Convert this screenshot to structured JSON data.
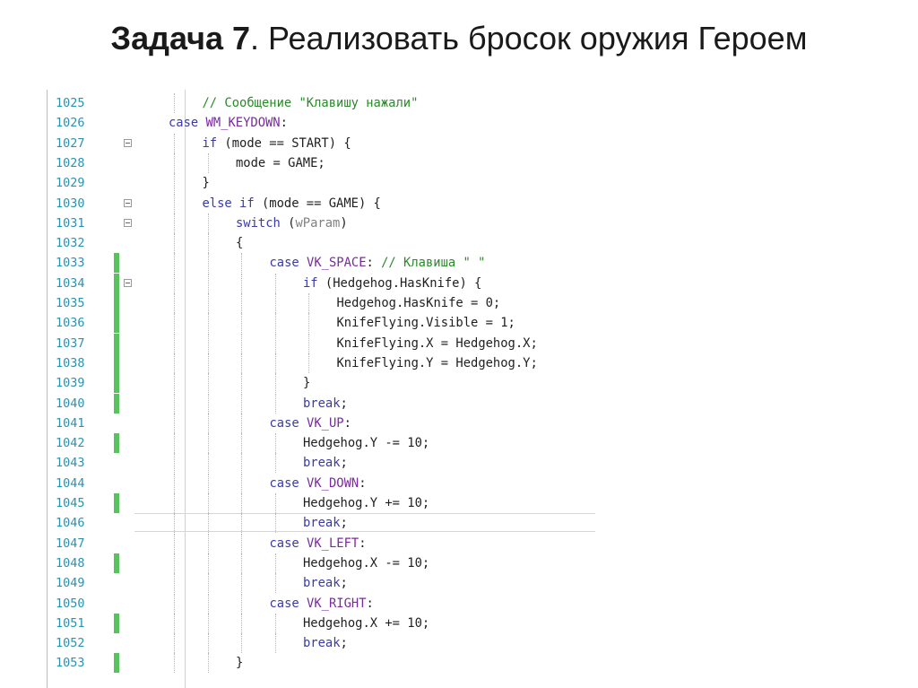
{
  "slide": {
    "title_bold": "Задача 7",
    "title_rest": ". Реализовать бросок оружия Героем"
  },
  "editor": {
    "lines": [
      {
        "num": "1025",
        "indent": 2,
        "bar": false,
        "fold": false,
        "parts": [
          {
            "t": "cm",
            "v": "// Сообщение \"Клавишу нажали\""
          }
        ]
      },
      {
        "num": "1026",
        "indent": 1,
        "bar": false,
        "fold": false,
        "parts": [
          {
            "t": "kw",
            "v": "case"
          },
          {
            "t": "tx",
            "v": " "
          },
          {
            "t": "mac",
            "v": "WM_KEYDOWN"
          },
          {
            "t": "tx",
            "v": ":"
          }
        ]
      },
      {
        "num": "1027",
        "indent": 2,
        "bar": false,
        "fold": true,
        "parts": [
          {
            "t": "kw",
            "v": "if"
          },
          {
            "t": "tx",
            "v": " (mode == START) {"
          }
        ]
      },
      {
        "num": "1028",
        "indent": 3,
        "bar": false,
        "fold": false,
        "parts": [
          {
            "t": "tx",
            "v": "mode = GAME;"
          }
        ]
      },
      {
        "num": "1029",
        "indent": 2,
        "bar": false,
        "fold": false,
        "parts": [
          {
            "t": "tx",
            "v": "}"
          }
        ]
      },
      {
        "num": "1030",
        "indent": 2,
        "bar": false,
        "fold": true,
        "parts": [
          {
            "t": "kw",
            "v": "else if"
          },
          {
            "t": "tx",
            "v": " (mode == GAME) {"
          }
        ]
      },
      {
        "num": "1031",
        "indent": 3,
        "bar": false,
        "fold": true,
        "parts": [
          {
            "t": "kw",
            "v": "switch"
          },
          {
            "t": "tx",
            "v": " ("
          },
          {
            "t": "par",
            "v": "wParam"
          },
          {
            "t": "tx",
            "v": ")"
          }
        ]
      },
      {
        "num": "1032",
        "indent": 3,
        "bar": false,
        "fold": false,
        "parts": [
          {
            "t": "tx",
            "v": "{"
          }
        ]
      },
      {
        "num": "1033",
        "indent": 4,
        "bar": true,
        "fold": false,
        "parts": [
          {
            "t": "kw",
            "v": "case"
          },
          {
            "t": "tx",
            "v": " "
          },
          {
            "t": "mac",
            "v": "VK_SPACE"
          },
          {
            "t": "tx",
            "v": ": "
          },
          {
            "t": "cm",
            "v": "// Клавиша \" \""
          }
        ]
      },
      {
        "num": "1034",
        "indent": 5,
        "bar": true,
        "fold": true,
        "parts": [
          {
            "t": "kw",
            "v": "if"
          },
          {
            "t": "tx",
            "v": " (Hedgehog.HasKnife) {"
          }
        ]
      },
      {
        "num": "1035",
        "indent": 6,
        "bar": true,
        "fold": false,
        "parts": [
          {
            "t": "tx",
            "v": "Hedgehog.HasKnife = 0;"
          }
        ]
      },
      {
        "num": "1036",
        "indent": 6,
        "bar": true,
        "fold": false,
        "parts": [
          {
            "t": "tx",
            "v": "KnifeFlying.Visible = 1;"
          }
        ]
      },
      {
        "num": "1037",
        "indent": 6,
        "bar": true,
        "fold": false,
        "parts": [
          {
            "t": "tx",
            "v": "KnifeFlying.X = Hedgehog.X;"
          }
        ]
      },
      {
        "num": "1038",
        "indent": 6,
        "bar": true,
        "fold": false,
        "parts": [
          {
            "t": "tx",
            "v": "KnifeFlying.Y = Hedgehog.Y;"
          }
        ]
      },
      {
        "num": "1039",
        "indent": 5,
        "bar": true,
        "fold": false,
        "parts": [
          {
            "t": "tx",
            "v": "}"
          }
        ]
      },
      {
        "num": "1040",
        "indent": 5,
        "bar": true,
        "fold": false,
        "parts": [
          {
            "t": "kw",
            "v": "break"
          },
          {
            "t": "tx",
            "v": ";"
          }
        ]
      },
      {
        "num": "1041",
        "indent": 4,
        "bar": false,
        "fold": false,
        "parts": [
          {
            "t": "kw",
            "v": "case"
          },
          {
            "t": "tx",
            "v": " "
          },
          {
            "t": "mac",
            "v": "VK_UP"
          },
          {
            "t": "tx",
            "v": ":"
          }
        ]
      },
      {
        "num": "1042",
        "indent": 5,
        "bar": true,
        "fold": false,
        "parts": [
          {
            "t": "tx",
            "v": "Hedgehog.Y -= 10;"
          }
        ]
      },
      {
        "num": "1043",
        "indent": 5,
        "bar": false,
        "fold": false,
        "parts": [
          {
            "t": "kw",
            "v": "break"
          },
          {
            "t": "tx",
            "v": ";"
          }
        ]
      },
      {
        "num": "1044",
        "indent": 4,
        "bar": false,
        "fold": false,
        "parts": [
          {
            "t": "kw",
            "v": "case"
          },
          {
            "t": "tx",
            "v": " "
          },
          {
            "t": "mac",
            "v": "VK_DOWN"
          },
          {
            "t": "tx",
            "v": ":"
          }
        ]
      },
      {
        "num": "1045",
        "indent": 5,
        "bar": true,
        "fold": false,
        "parts": [
          {
            "t": "tx",
            "v": "Hedgehog.Y += 10;"
          }
        ]
      },
      {
        "num": "1046",
        "indent": 5,
        "bar": false,
        "fold": false,
        "current": true,
        "parts": [
          {
            "t": "kw",
            "v": "break"
          },
          {
            "t": "tx",
            "v": ";"
          }
        ]
      },
      {
        "num": "1047",
        "indent": 4,
        "bar": false,
        "fold": false,
        "parts": [
          {
            "t": "kw",
            "v": "case"
          },
          {
            "t": "tx",
            "v": " "
          },
          {
            "t": "mac",
            "v": "VK_LEFT"
          },
          {
            "t": "tx",
            "v": ":"
          }
        ]
      },
      {
        "num": "1048",
        "indent": 5,
        "bar": true,
        "fold": false,
        "parts": [
          {
            "t": "tx",
            "v": "Hedgehog.X -= 10;"
          }
        ]
      },
      {
        "num": "1049",
        "indent": 5,
        "bar": false,
        "fold": false,
        "parts": [
          {
            "t": "kw",
            "v": "break"
          },
          {
            "t": "tx",
            "v": ";"
          }
        ]
      },
      {
        "num": "1050",
        "indent": 4,
        "bar": false,
        "fold": false,
        "parts": [
          {
            "t": "kw",
            "v": "case"
          },
          {
            "t": "tx",
            "v": " "
          },
          {
            "t": "mac",
            "v": "VK_RIGHT"
          },
          {
            "t": "tx",
            "v": ":"
          }
        ]
      },
      {
        "num": "1051",
        "indent": 5,
        "bar": true,
        "fold": false,
        "parts": [
          {
            "t": "tx",
            "v": "Hedgehog.X += 10;"
          }
        ]
      },
      {
        "num": "1052",
        "indent": 5,
        "bar": false,
        "fold": false,
        "parts": [
          {
            "t": "kw",
            "v": "break"
          },
          {
            "t": "tx",
            "v": ";"
          }
        ]
      },
      {
        "num": "1053",
        "indent": 3,
        "bar": true,
        "fold": false,
        "parts": [
          {
            "t": "tx",
            "v": "}"
          }
        ]
      }
    ]
  },
  "colors": {
    "keyword": "#3a3aa8",
    "comment": "#2a8a2a",
    "macro": "#7a2aa0",
    "line_number": "#2b91af",
    "change_bar": "#57c25e"
  }
}
